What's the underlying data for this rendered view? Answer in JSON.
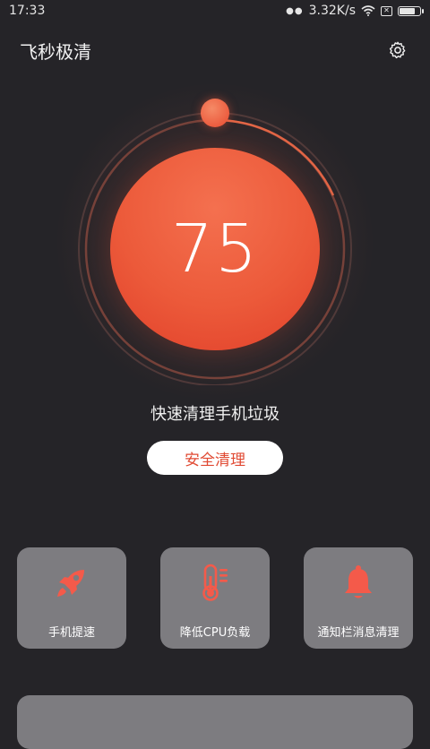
{
  "status_bar": {
    "time": "17:33",
    "network_speed": "3.32K/s",
    "icons": [
      "more-dots-icon",
      "wifi-icon",
      "sim-x-icon",
      "battery-icon"
    ],
    "battery_level": 0.85
  },
  "header": {
    "title": "飞秒极清",
    "settings_icon": "gear-icon"
  },
  "gauge": {
    "score": "75",
    "accent_color": "#ec5a3a"
  },
  "main": {
    "subtitle": "快速清理手机垃圾",
    "clean_button": "安全清理"
  },
  "features": [
    {
      "label": "手机提速",
      "icon": "rocket-icon"
    },
    {
      "label": "降低CPU负载",
      "icon": "thermometer-icon"
    },
    {
      "label": "通知栏消息清理",
      "icon": "bell-icon"
    }
  ],
  "colors": {
    "background": "#252428",
    "card": "#7d7c80",
    "icon_accent": "#f45a4a"
  }
}
